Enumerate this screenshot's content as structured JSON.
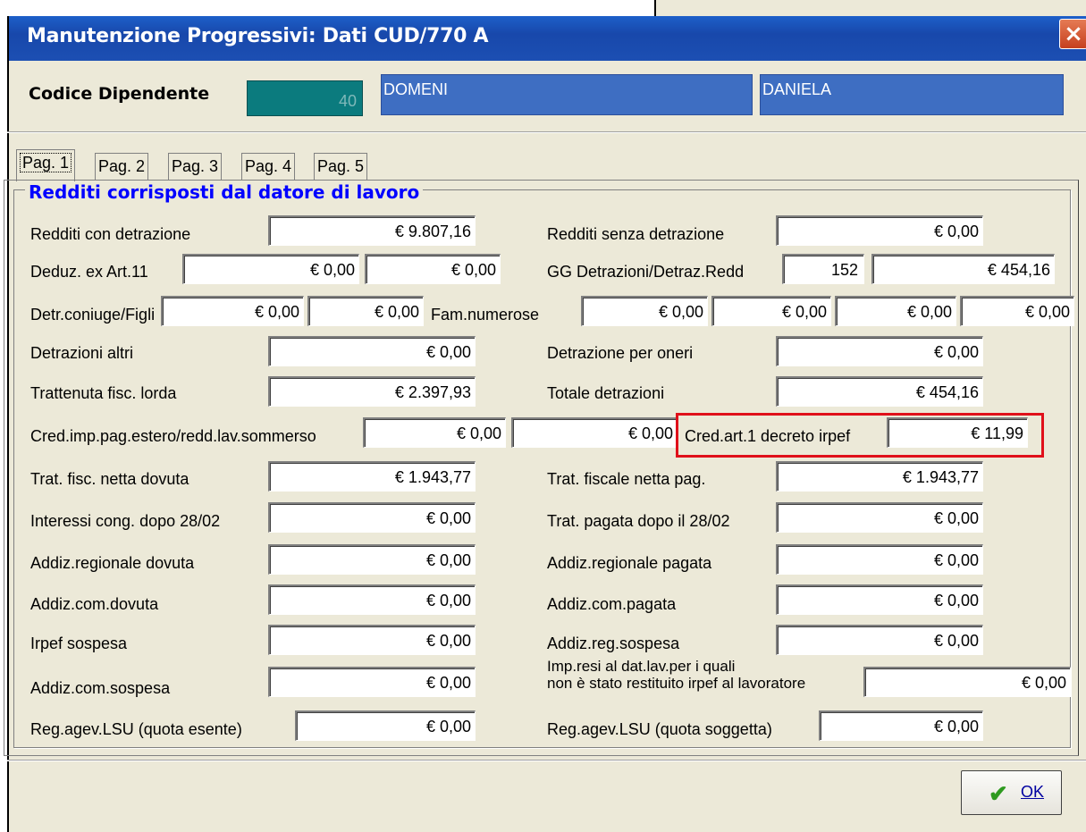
{
  "window": {
    "title": "Manutenzione Progressivi: Dati  CUD/770  A",
    "close_label": "×"
  },
  "employee": {
    "label": "Codice Dipendente",
    "code": "40",
    "surname": "DOMENI",
    "name": "DANIELA"
  },
  "tabs": [
    "Pag. 1",
    "Pag. 2",
    "Pag. 3",
    "Pag. 4",
    "Pag. 5"
  ],
  "active_tab": "Pag. 1",
  "group_title": "Redditi corrisposti dal datore di lavoro",
  "rows": {
    "redditi_con": {
      "label": "Redditi con detrazione",
      "value": "€ 9.807,16"
    },
    "redditi_senza": {
      "label": "Redditi senza detrazione",
      "value": "€ 0,00"
    },
    "deduz": {
      "label": "Deduz. ex Art.11",
      "value1": "€ 0,00",
      "value2": "€ 0,00"
    },
    "gg_detrazioni": {
      "label": "GG Detrazioni/Detraz.Redd",
      "days": "152",
      "value": "€ 454,16"
    },
    "detr_coniuge": {
      "label": "Detr.coniuge/Figli",
      "value1": "€ 0,00",
      "value2": "€ 0,00"
    },
    "fam_numerose": {
      "label": "Fam.numerose",
      "value1": "€ 0,00",
      "value2": "€ 0,00",
      "value3": "€ 0,00",
      "value4": "€ 0,00"
    },
    "detrazioni_altri": {
      "label": "Detrazioni altri",
      "value": "€ 0,00"
    },
    "detrazione_oneri": {
      "label": "Detrazione per oneri",
      "value": "€ 0,00"
    },
    "trattenuta_lorda": {
      "label": "Trattenuta fisc. lorda",
      "value": "€ 2.397,93"
    },
    "totale_detrazioni": {
      "label": "Totale detrazioni",
      "value": "€ 454,16"
    },
    "cred_imp": {
      "label": "Cred.imp.pag.estero/redd.lav.sommerso",
      "value1": "€ 0,00",
      "value2": "€ 0,00"
    },
    "cred_art1": {
      "label": "Cred.art.1 decreto irpef",
      "value": "€ 11,99"
    },
    "trat_netta_dovuta": {
      "label": "Trat. fisc. netta dovuta",
      "value": "€ 1.943,77"
    },
    "trat_netta_pag": {
      "label": "Trat. fiscale  netta pag.",
      "value": "€ 1.943,77"
    },
    "interessi": {
      "label": "Interessi cong. dopo 28/02",
      "value": "€ 0,00"
    },
    "trat_pagata_dopo": {
      "label": "Trat. pagata dopo il 28/02",
      "value": "€ 0,00"
    },
    "addiz_reg_dovuta": {
      "label": "Addiz.regionale dovuta",
      "value": "€ 0,00"
    },
    "addiz_reg_pagata": {
      "label": "Addiz.regionale pagata",
      "value": "€ 0,00"
    },
    "addiz_com_dovuta": {
      "label": "Addiz.com.dovuta",
      "value": "€ 0,00"
    },
    "addiz_com_pagata": {
      "label": "Addiz.com.pagata",
      "value": "€ 0,00"
    },
    "irpef_sospesa": {
      "label": "Irpef sospesa",
      "value": "€ 0,00"
    },
    "addiz_reg_sospesa": {
      "label": "Addiz.reg.sospesa",
      "value": "€ 0,00"
    },
    "addiz_com_sospesa": {
      "label": "Addiz.com.sospesa",
      "value": "€ 0,00"
    },
    "imp_resi": {
      "label_line1": "Imp.resi al dat.lav.per i quali",
      "label_line2": "non è stato restituito irpef al lavoratore",
      "value": "€ 0,00"
    },
    "reg_agev_esente": {
      "label": "Reg.agev.LSU (quota esente)",
      "value": "€ 0,00"
    },
    "reg_agev_soggetta": {
      "label": "Reg.agev.LSU (quota soggetta)",
      "value": "€ 0,00"
    }
  },
  "ok_button": {
    "label": "OK"
  },
  "colors": {
    "titlebar": "#1848ab",
    "employee_code_bg": "#0b7b7e",
    "employee_name_bg": "#3e6ec2",
    "group_title": "#0000ff",
    "highlight": "#e0101a"
  }
}
